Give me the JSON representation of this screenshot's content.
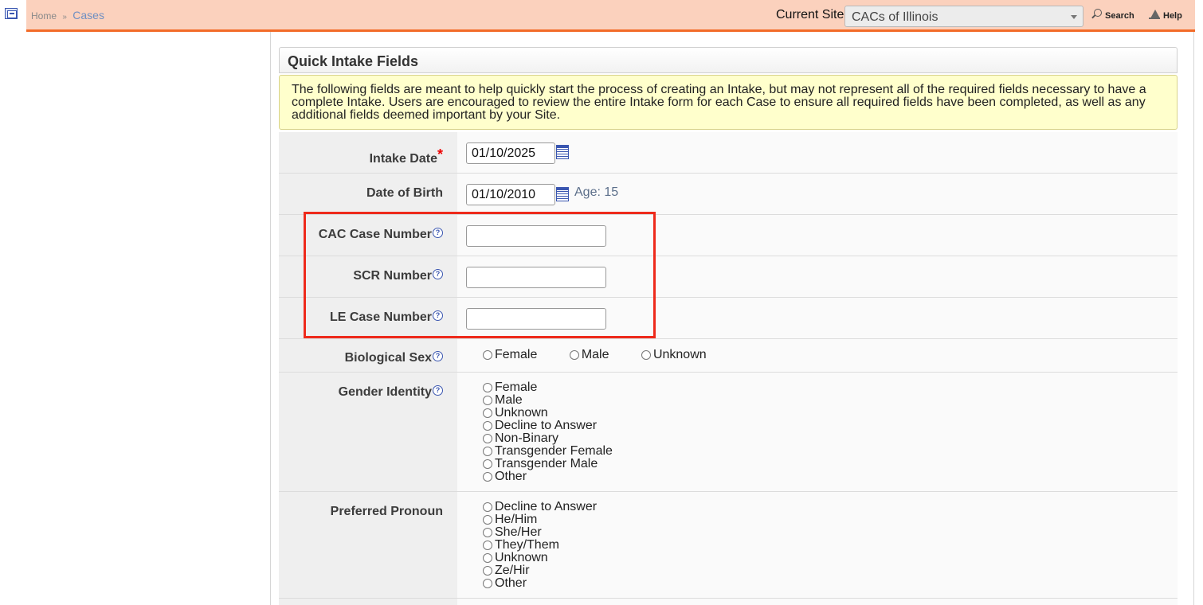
{
  "breadcrumb": {
    "home": "Home",
    "separator": "»",
    "current": "Cases"
  },
  "header": {
    "current_site_label": "Current Site",
    "current_site_value": "CACs of Illinois",
    "search_label": "Search",
    "help_label": "Help"
  },
  "panel": {
    "title": "Quick Intake Fields",
    "notice": "The following fields are meant to help quickly start the process of creating an Intake, but may not represent all of the required fields necessary to have a complete Intake. Users are encouraged to review the entire Intake form for each Case to ensure all required fields have been completed, as well as any additional fields deemed important by your Site."
  },
  "form": {
    "intake_date": {
      "label": "Intake Date",
      "required": "*",
      "value": "01/10/2025"
    },
    "dob": {
      "label": "Date of Birth",
      "value": "01/10/2010",
      "age": "Age: 15"
    },
    "cac_case_number": {
      "label": "CAC Case Number",
      "value": ""
    },
    "scr_number": {
      "label": "SCR Number",
      "value": ""
    },
    "le_case_number": {
      "label": "LE Case Number",
      "value": ""
    },
    "biological_sex": {
      "label": "Biological Sex",
      "options": [
        "Female",
        "Male",
        "Unknown"
      ]
    },
    "gender_identity": {
      "label": "Gender Identity",
      "options": [
        "Female",
        "Male",
        "Unknown",
        "Decline to Answer",
        "Non-Binary",
        "Transgender Female",
        "Transgender Male",
        "Other"
      ]
    },
    "preferred_pronoun": {
      "label": "Preferred Pronoun",
      "options": [
        "Decline to Answer",
        "He/Him",
        "She/Her",
        "They/Them",
        "Unknown",
        "Ze/Hir",
        "Other"
      ]
    }
  },
  "help_icon_glyph": "?",
  "colors": {
    "topbar": "#fbd1bd",
    "topbar_border": "#f26b28",
    "notice_bg": "#ffffcc",
    "highlight": "#ee2a1b"
  }
}
